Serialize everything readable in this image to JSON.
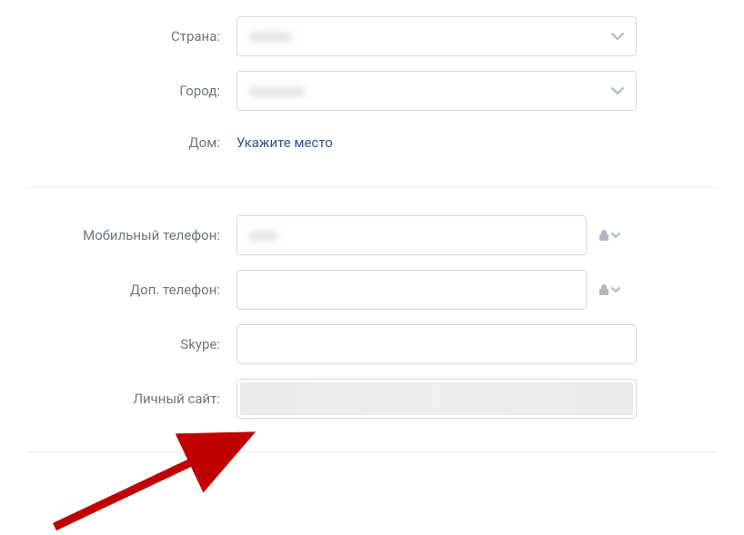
{
  "location": {
    "country_label": "Страна:",
    "country_value": "",
    "city_label": "Город:",
    "city_value": "",
    "home_label": "Дом:",
    "home_link": "Укажите место"
  },
  "contacts": {
    "mobile_label": "Мобильный телефон:",
    "mobile_value": "",
    "alt_phone_label": "Доп. телефон:",
    "alt_phone_value": "",
    "skype_label": "Skype:",
    "skype_value": "",
    "website_label": "Личный сайт:",
    "website_value": ""
  }
}
